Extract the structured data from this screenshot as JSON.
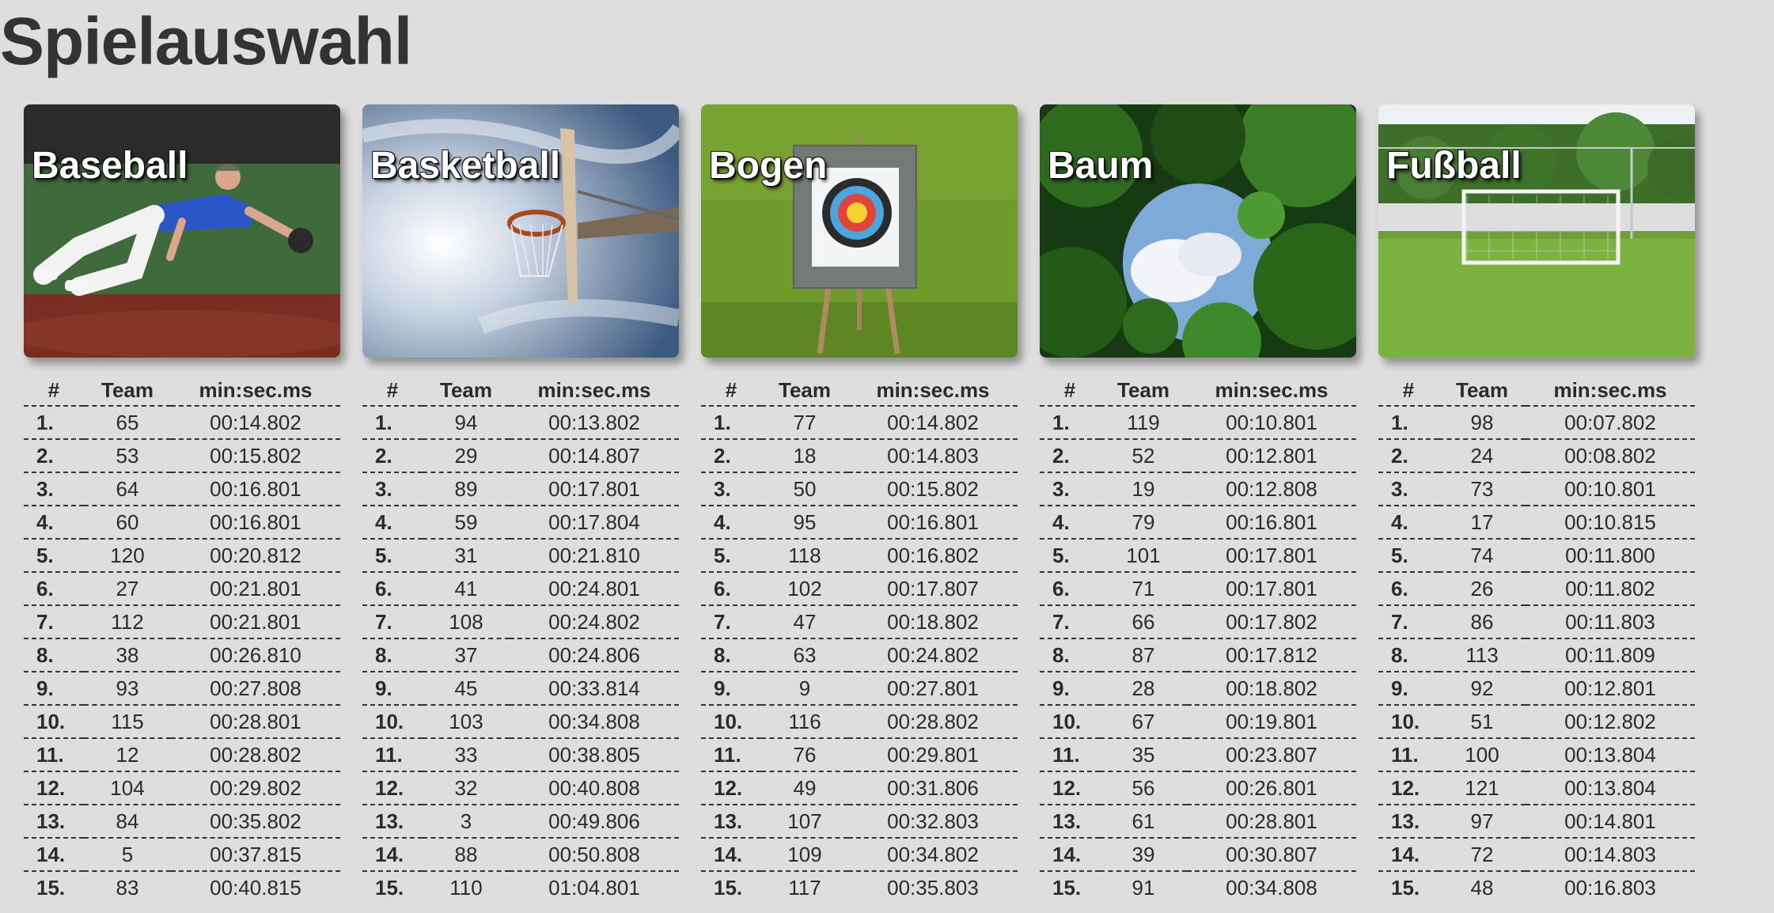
{
  "title": "Spielauswahl",
  "table_headers": {
    "rank": "#",
    "team": "Team",
    "time": "min:sec.ms"
  },
  "games": [
    {
      "name": "Baseball",
      "rows": [
        {
          "rank": "1.",
          "team": "65",
          "time": "00:14.802"
        },
        {
          "rank": "2.",
          "team": "53",
          "time": "00:15.802"
        },
        {
          "rank": "3.",
          "team": "64",
          "time": "00:16.801"
        },
        {
          "rank": "4.",
          "team": "60",
          "time": "00:16.801"
        },
        {
          "rank": "5.",
          "team": "120",
          "time": "00:20.812"
        },
        {
          "rank": "6.",
          "team": "27",
          "time": "00:21.801"
        },
        {
          "rank": "7.",
          "team": "112",
          "time": "00:21.801"
        },
        {
          "rank": "8.",
          "team": "38",
          "time": "00:26.810"
        },
        {
          "rank": "9.",
          "team": "93",
          "time": "00:27.808"
        },
        {
          "rank": "10.",
          "team": "115",
          "time": "00:28.801"
        },
        {
          "rank": "11.",
          "team": "12",
          "time": "00:28.802"
        },
        {
          "rank": "12.",
          "team": "104",
          "time": "00:29.802"
        },
        {
          "rank": "13.",
          "team": "84",
          "time": "00:35.802"
        },
        {
          "rank": "14.",
          "team": "5",
          "time": "00:37.815"
        },
        {
          "rank": "15.",
          "team": "83",
          "time": "00:40.815"
        }
      ]
    },
    {
      "name": "Basketball",
      "rows": [
        {
          "rank": "1.",
          "team": "94",
          "time": "00:13.802"
        },
        {
          "rank": "2.",
          "team": "29",
          "time": "00:14.807"
        },
        {
          "rank": "3.",
          "team": "89",
          "time": "00:17.801"
        },
        {
          "rank": "4.",
          "team": "59",
          "time": "00:17.804"
        },
        {
          "rank": "5.",
          "team": "31",
          "time": "00:21.810"
        },
        {
          "rank": "6.",
          "team": "41",
          "time": "00:24.801"
        },
        {
          "rank": "7.",
          "team": "108",
          "time": "00:24.802"
        },
        {
          "rank": "8.",
          "team": "37",
          "time": "00:24.806"
        },
        {
          "rank": "9.",
          "team": "45",
          "time": "00:33.814"
        },
        {
          "rank": "10.",
          "team": "103",
          "time": "00:34.808"
        },
        {
          "rank": "11.",
          "team": "33",
          "time": "00:38.805"
        },
        {
          "rank": "12.",
          "team": "32",
          "time": "00:40.808"
        },
        {
          "rank": "13.",
          "team": "3",
          "time": "00:49.806"
        },
        {
          "rank": "14.",
          "team": "88",
          "time": "00:50.808"
        },
        {
          "rank": "15.",
          "team": "110",
          "time": "01:04.801"
        }
      ]
    },
    {
      "name": "Bogen",
      "rows": [
        {
          "rank": "1.",
          "team": "77",
          "time": "00:14.802"
        },
        {
          "rank": "2.",
          "team": "18",
          "time": "00:14.803"
        },
        {
          "rank": "3.",
          "team": "50",
          "time": "00:15.802"
        },
        {
          "rank": "4.",
          "team": "95",
          "time": "00:16.801"
        },
        {
          "rank": "5.",
          "team": "118",
          "time": "00:16.802"
        },
        {
          "rank": "6.",
          "team": "102",
          "time": "00:17.807"
        },
        {
          "rank": "7.",
          "team": "47",
          "time": "00:18.802"
        },
        {
          "rank": "8.",
          "team": "63",
          "time": "00:24.802"
        },
        {
          "rank": "9.",
          "team": "9",
          "time": "00:27.801"
        },
        {
          "rank": "10.",
          "team": "116",
          "time": "00:28.802"
        },
        {
          "rank": "11.",
          "team": "76",
          "time": "00:29.801"
        },
        {
          "rank": "12.",
          "team": "49",
          "time": "00:31.806"
        },
        {
          "rank": "13.",
          "team": "107",
          "time": "00:32.803"
        },
        {
          "rank": "14.",
          "team": "109",
          "time": "00:34.802"
        },
        {
          "rank": "15.",
          "team": "117",
          "time": "00:35.803"
        }
      ]
    },
    {
      "name": "Baum",
      "rows": [
        {
          "rank": "1.",
          "team": "119",
          "time": "00:10.801"
        },
        {
          "rank": "2.",
          "team": "52",
          "time": "00:12.801"
        },
        {
          "rank": "3.",
          "team": "19",
          "time": "00:12.808"
        },
        {
          "rank": "4.",
          "team": "79",
          "time": "00:16.801"
        },
        {
          "rank": "5.",
          "team": "101",
          "time": "00:17.801"
        },
        {
          "rank": "6.",
          "team": "71",
          "time": "00:17.801"
        },
        {
          "rank": "7.",
          "team": "66",
          "time": "00:17.802"
        },
        {
          "rank": "8.",
          "team": "87",
          "time": "00:17.812"
        },
        {
          "rank": "9.",
          "team": "28",
          "time": "00:18.802"
        },
        {
          "rank": "10.",
          "team": "67",
          "time": "00:19.801"
        },
        {
          "rank": "11.",
          "team": "35",
          "time": "00:23.807"
        },
        {
          "rank": "12.",
          "team": "56",
          "time": "00:26.801"
        },
        {
          "rank": "13.",
          "team": "61",
          "time": "00:28.801"
        },
        {
          "rank": "14.",
          "team": "39",
          "time": "00:30.807"
        },
        {
          "rank": "15.",
          "team": "91",
          "time": "00:34.808"
        }
      ]
    },
    {
      "name": "Fußball",
      "rows": [
        {
          "rank": "1.",
          "team": "98",
          "time": "00:07.802"
        },
        {
          "rank": "2.",
          "team": "24",
          "time": "00:08.802"
        },
        {
          "rank": "3.",
          "team": "73",
          "time": "00:10.801"
        },
        {
          "rank": "4.",
          "team": "17",
          "time": "00:10.815"
        },
        {
          "rank": "5.",
          "team": "74",
          "time": "00:11.800"
        },
        {
          "rank": "6.",
          "team": "26",
          "time": "00:11.802"
        },
        {
          "rank": "7.",
          "team": "86",
          "time": "00:11.803"
        },
        {
          "rank": "8.",
          "team": "113",
          "time": "00:11.809"
        },
        {
          "rank": "9.",
          "team": "92",
          "time": "00:12.801"
        },
        {
          "rank": "10.",
          "team": "51",
          "time": "00:12.802"
        },
        {
          "rank": "11.",
          "team": "100",
          "time": "00:13.804"
        },
        {
          "rank": "12.",
          "team": "121",
          "time": "00:13.804"
        },
        {
          "rank": "13.",
          "team": "97",
          "time": "00:14.801"
        },
        {
          "rank": "14.",
          "team": "72",
          "time": "00:14.803"
        },
        {
          "rank": "15.",
          "team": "48",
          "time": "00:16.803"
        }
      ]
    }
  ]
}
